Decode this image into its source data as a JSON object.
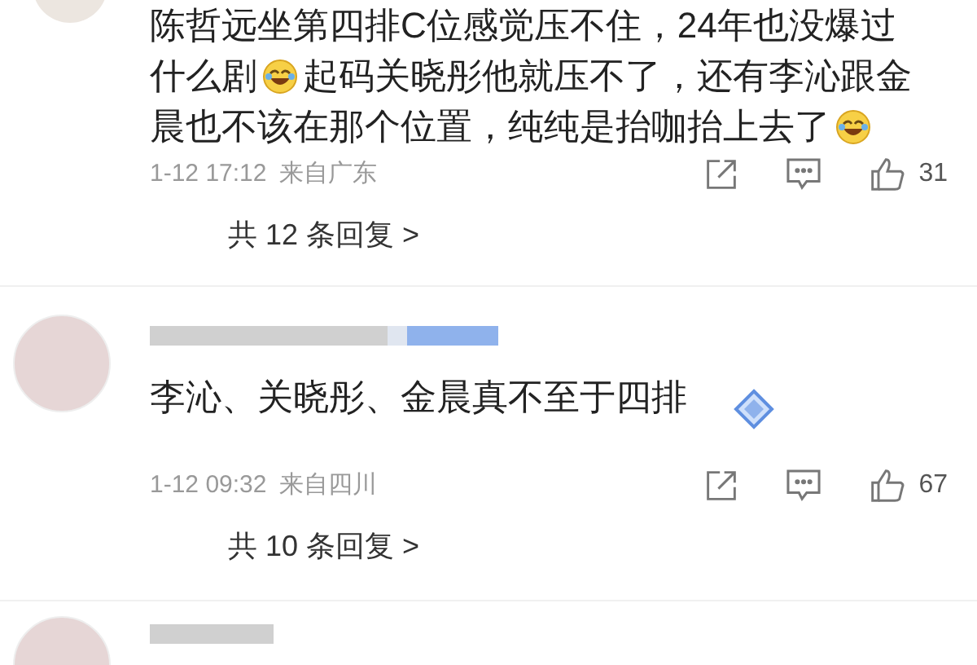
{
  "comments": [
    {
      "lines": [
        [
          {
            "text": "陈哲远坐第四排C位感觉压不住，24年也没爆过",
            "emoji": false
          }
        ],
        [
          {
            "text": "什么剧",
            "emoji": true
          },
          {
            "text": "起码关晓彤他就压不了，还有李沁跟金",
            "emoji": false
          }
        ],
        [
          {
            "text": "晨也不该在那个位置，纯纯是抬咖抬上去了",
            "emoji": true
          }
        ]
      ],
      "badge": false,
      "time": "1-12 17:12",
      "location": "来自广东",
      "likes": "31",
      "replies": "共 12 条回复 >"
    },
    {
      "lines": [
        [
          {
            "text": "李沁、关晓彤、金晨真不至于四排",
            "emoji": false
          }
        ]
      ],
      "badge": true,
      "time": "1-12 09:32",
      "location": "来自四川",
      "likes": "67",
      "replies": "共 10 条回复 >"
    }
  ]
}
